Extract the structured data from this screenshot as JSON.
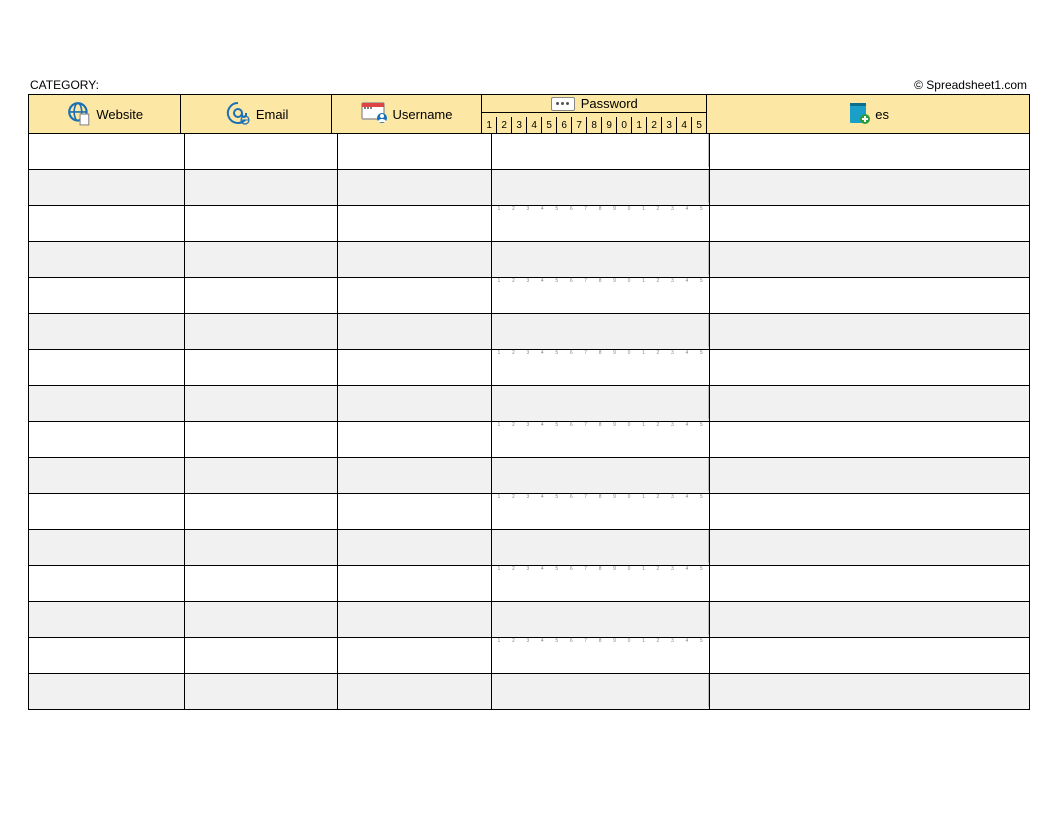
{
  "top": {
    "category_label": "CATEGORY:",
    "copyright": "© Spreadsheet1.com"
  },
  "headers": {
    "website": "Website",
    "email": "Email",
    "username": "Username",
    "password": "Password",
    "notes": "es"
  },
  "password_digits": [
    "1",
    "2",
    "3",
    "4",
    "5",
    "6",
    "7",
    "8",
    "9",
    "0",
    "1",
    "2",
    "3",
    "4",
    "5"
  ],
  "row_count": 16,
  "shaded_rows": [
    1,
    3,
    5,
    7,
    9,
    11,
    13,
    15
  ],
  "hint_rows": [
    2,
    4,
    6,
    8,
    10,
    12,
    14
  ]
}
